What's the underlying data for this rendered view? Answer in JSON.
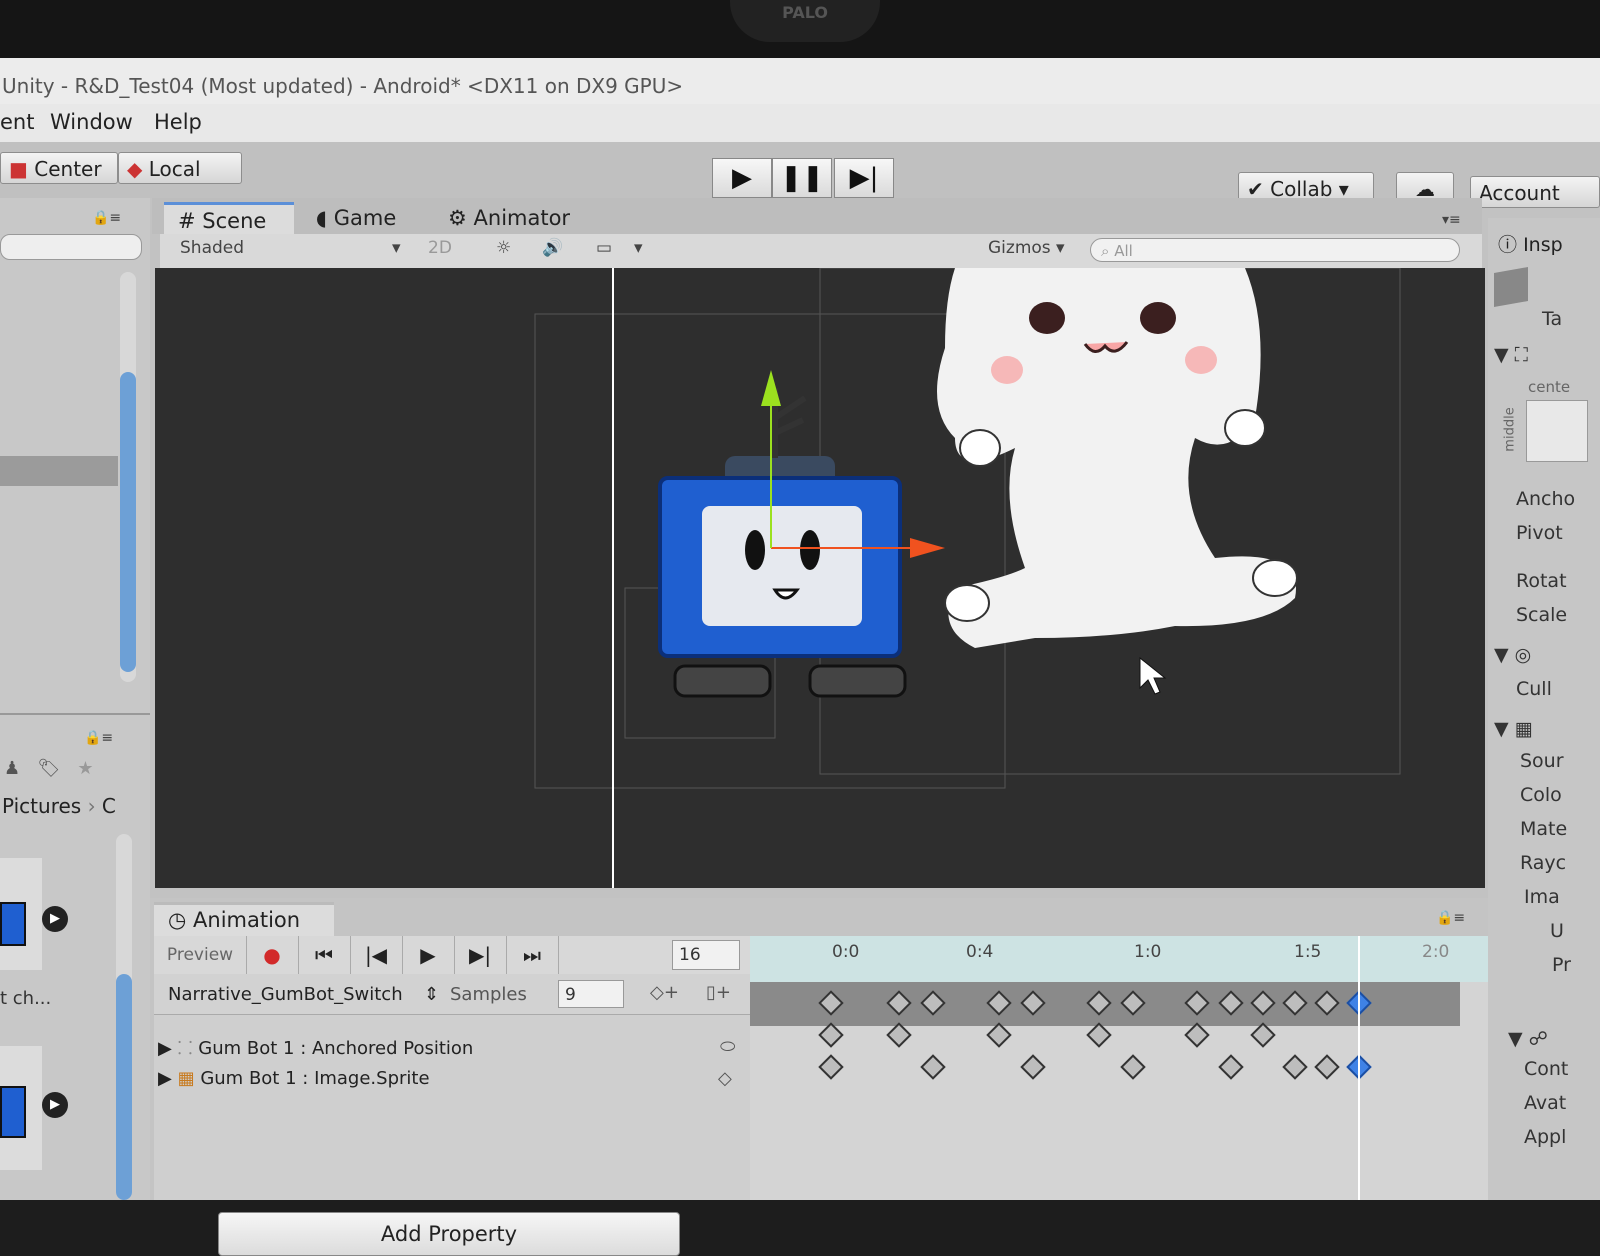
{
  "bezel": {
    "webcam_label": "PALO"
  },
  "window": {
    "title": "Unity - R&D_Test04 (Most updated) - Android* <DX11 on DX9 GPU>"
  },
  "menu": {
    "items": [
      "ent",
      "Window",
      "Help"
    ]
  },
  "toolbar": {
    "pivot_center": "Center",
    "pivot_local": "Local",
    "collab": "Collab ▾",
    "account": "Account"
  },
  "tabs": [
    {
      "label": "Scene",
      "active": true
    },
    {
      "label": "Game"
    },
    {
      "label": "Animator"
    }
  ],
  "scene_bar": {
    "shading": "Shaded",
    "mode_2d": "2D",
    "gizmos": "Gizmos ▾",
    "search_placeholder": "All"
  },
  "project_panel": {
    "breadcrumb": "Pictures",
    "breadcrumb_next": "C",
    "item_label": "t ch..."
  },
  "inspector": {
    "title": "Insp",
    "tag": "Ta",
    "anchor_preset_top": "cente",
    "anchor_preset_side": "middle",
    "rows_a": [
      "Ancho",
      "Pivot",
      "Rotat",
      "Scale"
    ],
    "cull": "Cull",
    "rows_b": [
      "Sour",
      "Colo",
      "Mate",
      "Rayc",
      "Ima"
    ],
    "rows_b_extra": [
      "U",
      "Pr"
    ],
    "rows_c": [
      "Cont",
      "Avat",
      "Appl"
    ]
  },
  "animation": {
    "tab": "Animation",
    "preview": "Preview",
    "frame": "16",
    "clip": "Narrative_GumBot_Switch",
    "samples_label": "Samples",
    "samples_value": "9",
    "properties": [
      {
        "object": "Gum Bot 1",
        "property": "Anchored Position"
      },
      {
        "object": "Gum Bot 1",
        "property": "Image.Sprite"
      }
    ],
    "add_property": "Add Property",
    "ruler_labels": [
      "0:0",
      "0:4",
      "1:0",
      "1:5",
      "2:0"
    ]
  },
  "colors": {
    "accent_blue": "#3f82e6",
    "record_red": "#d22a2a",
    "gizmo_green": "#9be11f",
    "gizmo_red": "#f0521f",
    "robot_blue": "#1f5fd0"
  }
}
